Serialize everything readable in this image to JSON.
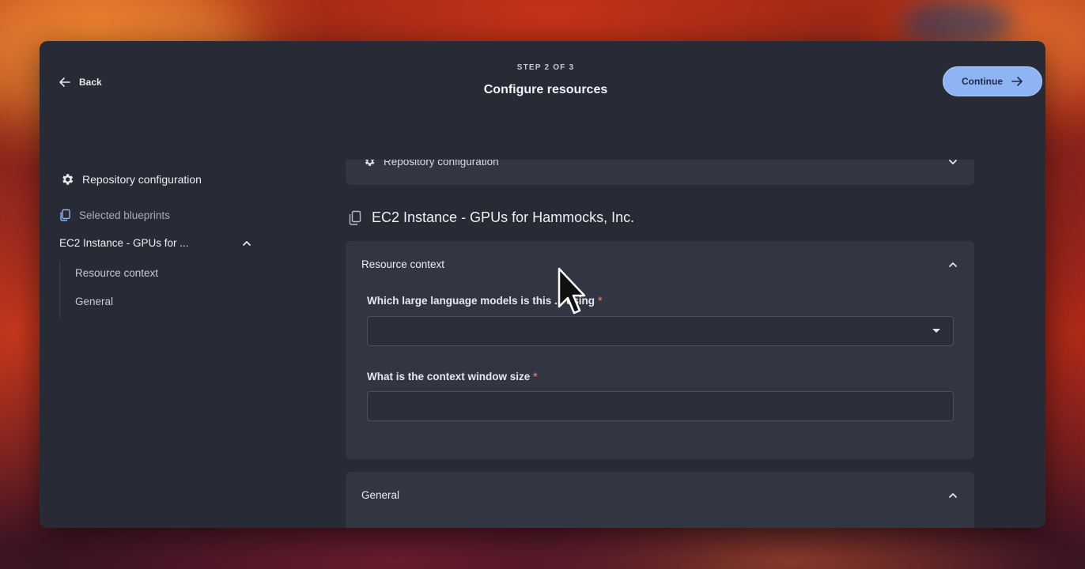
{
  "header": {
    "back_label": "Back",
    "step_label": "STEP 2 OF 3",
    "title": "Configure resources",
    "continue_label": "Continue"
  },
  "sidebar": {
    "repo_config": "Repository configuration",
    "selected_blueprints": "Selected blueprints",
    "instance_label": "EC2 Instance - GPUs for ...",
    "sub_items": [
      "Resource context",
      "General"
    ]
  },
  "main": {
    "repo_card_title": "Repository configuration",
    "blueprint_title": "EC2 Instance - GPUs for Hammocks, Inc.",
    "context_card": {
      "title": "Resource context",
      "field1_label": "Which large language models is this ... using",
      "field1_value": "",
      "field2_label": "What is the context window size",
      "field2_value": "",
      "required_mark": "*"
    },
    "general_card": {
      "title": "General"
    }
  },
  "colors": {
    "window_bg": "#282a36",
    "card_bg": "#323542",
    "accent_button": "#8fb4f4",
    "required": "#e7694f"
  },
  "icons": [
    "arrow-left-icon",
    "arrow-right-icon",
    "gear-icon",
    "copy-icon",
    "chevron-up-icon",
    "chevron-down-icon",
    "caret-down-icon",
    "mouse-pointer-icon"
  ]
}
